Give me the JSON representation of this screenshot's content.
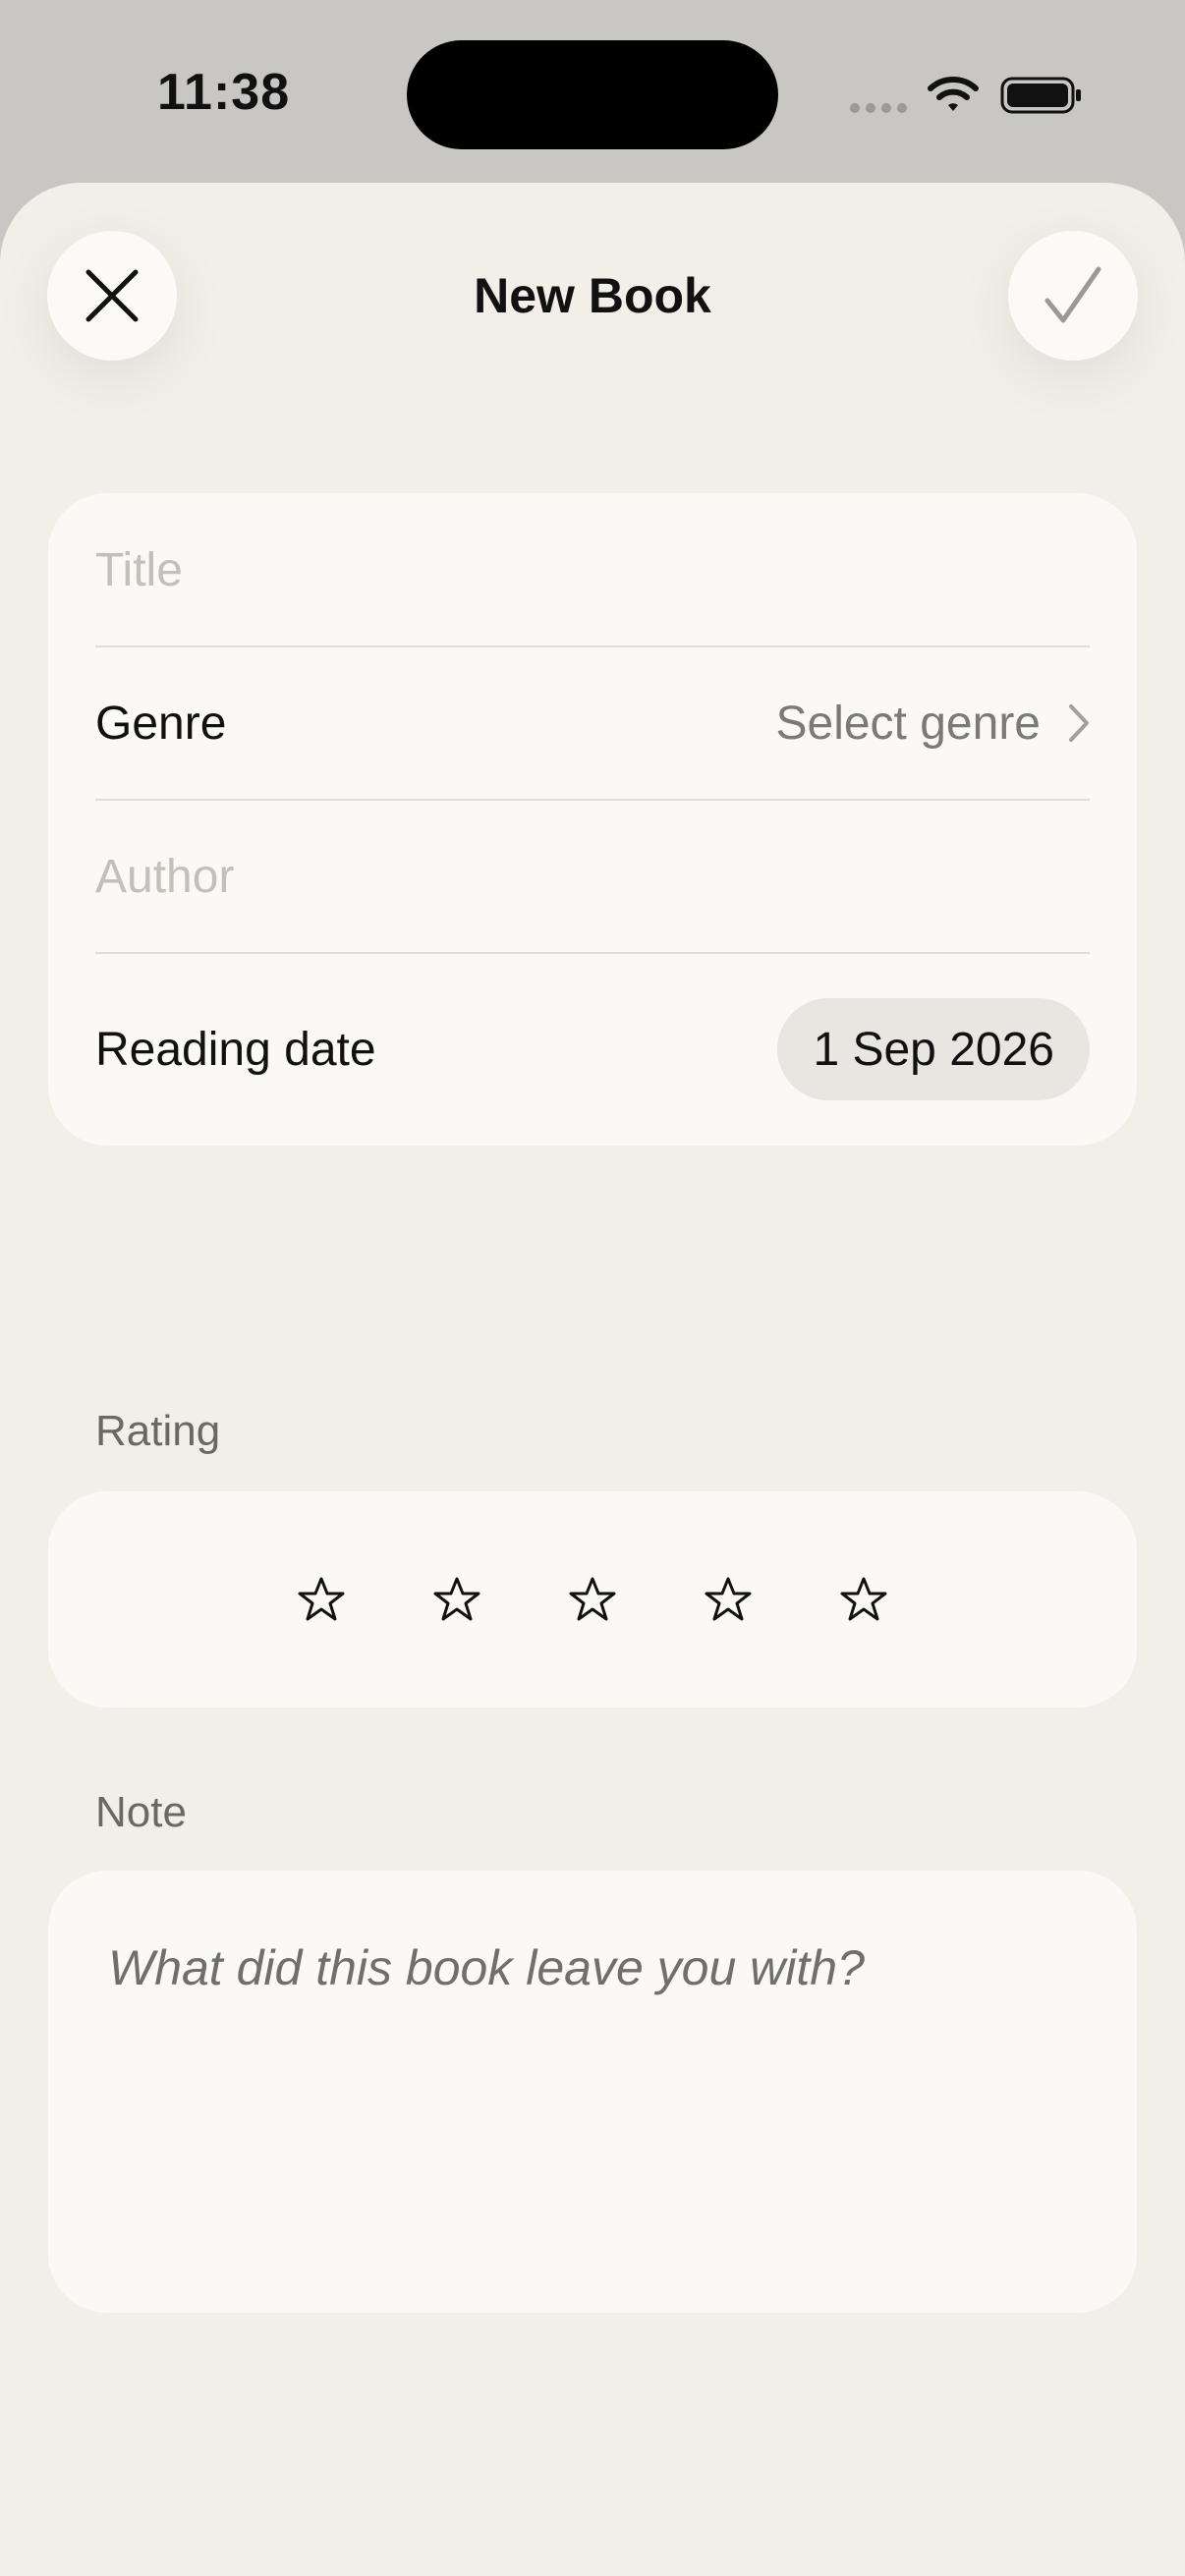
{
  "status_bar": {
    "time": "11:38"
  },
  "header": {
    "title": "New Book",
    "close_icon": "close-icon",
    "done_icon": "checkmark-icon"
  },
  "form": {
    "title_placeholder": "Title",
    "genre_label": "Genre",
    "genre_value": "Select genre",
    "author_placeholder": "Author",
    "reading_date_label": "Reading date",
    "reading_date_value": "1 Sep 2026"
  },
  "rating": {
    "label": "Rating",
    "value": 0,
    "max": 5
  },
  "note": {
    "label": "Note",
    "placeholder": "What did this book leave you with?"
  },
  "colors": {
    "sheet_background": "#f2efe9",
    "card_background": "#faf9f5",
    "status_background": "#c8c7c4",
    "placeholder": "#c3c0ba",
    "secondary_text": "#7d7a75"
  }
}
